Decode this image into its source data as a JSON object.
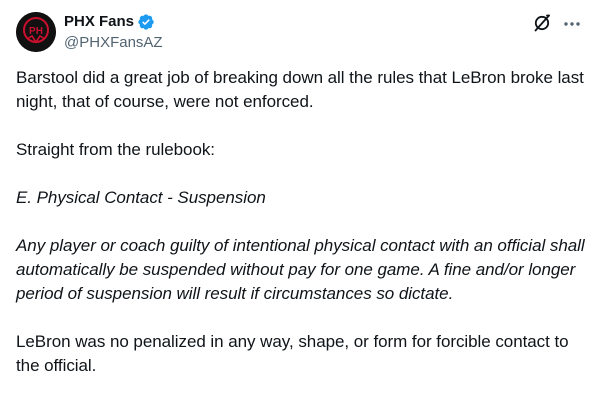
{
  "author": {
    "display_name": "PHX Fans",
    "handle": "@PHXFansAZ",
    "avatar_text": "PH",
    "verified": true
  },
  "tweet": {
    "paragraphs": [
      "Barstool did a great job of breaking down all the rules that LeBron broke last night, that of course, were not enforced.",
      "Straight from the rulebook:",
      "E. Physical Contact - Suspension",
      "Any player or coach guilty of intentional physical contact with an official shall automatically be suspended without pay for one game. A fine and/or longer period of suspension will result if circumstances so dictate.",
      "LeBron was no penalized in any way, shape, or form for forcible contact to the official."
    ]
  },
  "icons": {
    "verified": "verified-badge-icon",
    "grok": "grok-icon",
    "more": "more-options-icon"
  },
  "colors": {
    "text": "#0f1419",
    "secondary": "#536471",
    "verified": "#1d9bf0",
    "avatar_bg": "#111111",
    "avatar_accent": "#c8102e"
  }
}
